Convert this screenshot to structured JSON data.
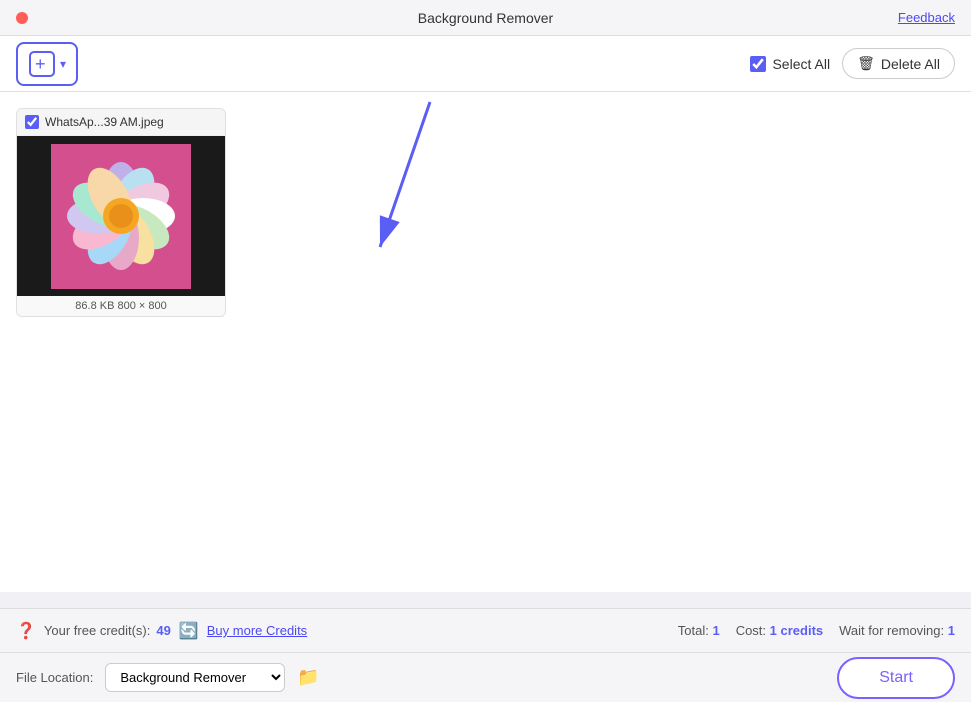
{
  "titleBar": {
    "title": "Background Remover",
    "feedback": "Feedback"
  },
  "toolbar": {
    "addButton": {
      "label": "▾",
      "ariaLabel": "Add Files"
    },
    "selectAll": {
      "label": "Select All",
      "checked": true
    },
    "deleteAll": {
      "label": "Delete All"
    }
  },
  "imageCard": {
    "filename": "WhatsAp...39 AM.jpeg",
    "fileInfo": "86.8 KB 800 × 800",
    "checked": true
  },
  "bottomBar": {
    "creditsLabel": "Your free credit(s):",
    "creditsCount": "49",
    "buyCredits": "Buy more Credits",
    "total": "Total:",
    "totalValue": "1",
    "cost": "Cost:",
    "costValue": "1 credits",
    "waitLabel": "Wait for removing:",
    "waitValue": "1"
  },
  "fileLocationBar": {
    "label": "File Location:",
    "selectValue": "Background Remover",
    "startButton": "Start"
  }
}
